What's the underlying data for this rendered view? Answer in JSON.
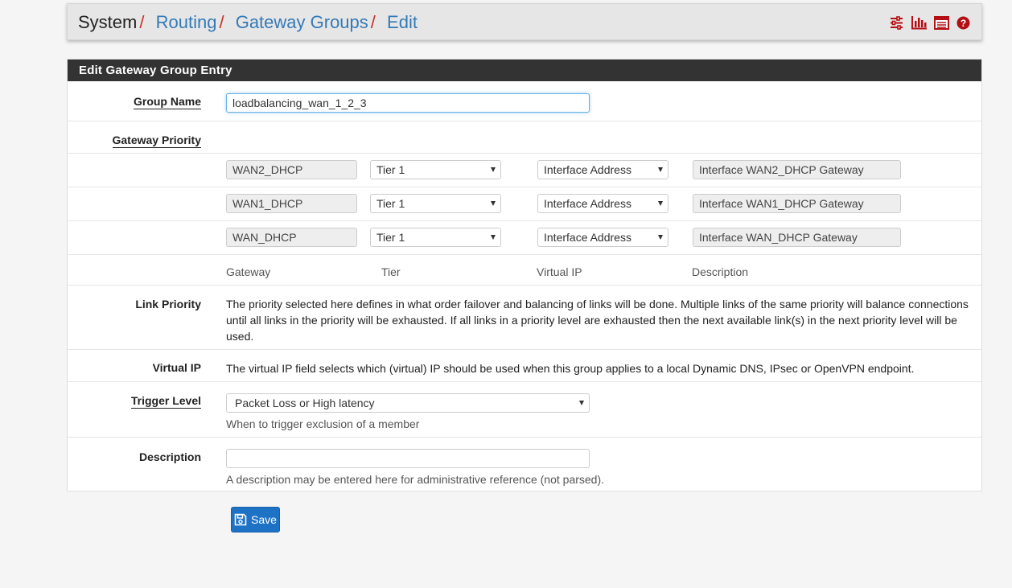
{
  "breadcrumb": {
    "root": "System",
    "items": [
      "Routing",
      "Gateway Groups",
      "Edit"
    ],
    "separator": "/"
  },
  "header_icons": [
    "sliders-icon",
    "bar-chart-icon",
    "list-icon",
    "help-icon"
  ],
  "panel": {
    "title": "Edit Gateway Group Entry"
  },
  "form": {
    "group_name": {
      "label": "Group Name",
      "value": "loadbalancing_wan_1_2_3"
    },
    "gateway_priority": {
      "label": "Gateway Priority",
      "rows": [
        {
          "gateway": "WAN2_DHCP",
          "tier": "Tier 1",
          "virtual_ip": "Interface Address",
          "description": "Interface WAN2_DHCP Gateway"
        },
        {
          "gateway": "WAN1_DHCP",
          "tier": "Tier 1",
          "virtual_ip": "Interface Address",
          "description": "Interface WAN1_DHCP Gateway"
        },
        {
          "gateway": "WAN_DHCP",
          "tier": "Tier 1",
          "virtual_ip": "Interface Address",
          "description": "Interface WAN_DHCP Gateway"
        }
      ],
      "columns": [
        "Gateway",
        "Tier",
        "Virtual IP",
        "Description"
      ]
    },
    "link_priority": {
      "label": "Link Priority",
      "text": "The priority selected here defines in what order failover and balancing of links will be done. Multiple links of the same priority will balance connections until all links in the priority will be exhausted. If all links in a priority level are exhausted then the next available link(s) in the next priority level will be used."
    },
    "virtual_ip": {
      "label": "Virtual IP",
      "text": "The virtual IP field selects which (virtual) IP should be used when this group applies to a local Dynamic DNS, IPsec or OpenVPN endpoint."
    },
    "trigger_level": {
      "label": "Trigger Level",
      "value": "Packet Loss or High latency",
      "help": "When to trigger exclusion of a member"
    },
    "description": {
      "label": "Description",
      "value": "",
      "help": "A description may be entered here for administrative reference (not parsed)."
    }
  },
  "save_button": {
    "label": "Save"
  },
  "colors": {
    "link": "#337ab7",
    "separator": "#c9302c",
    "panel_heading": "#333333",
    "save": "#1e72c6",
    "icon_red": "#b40f14"
  }
}
